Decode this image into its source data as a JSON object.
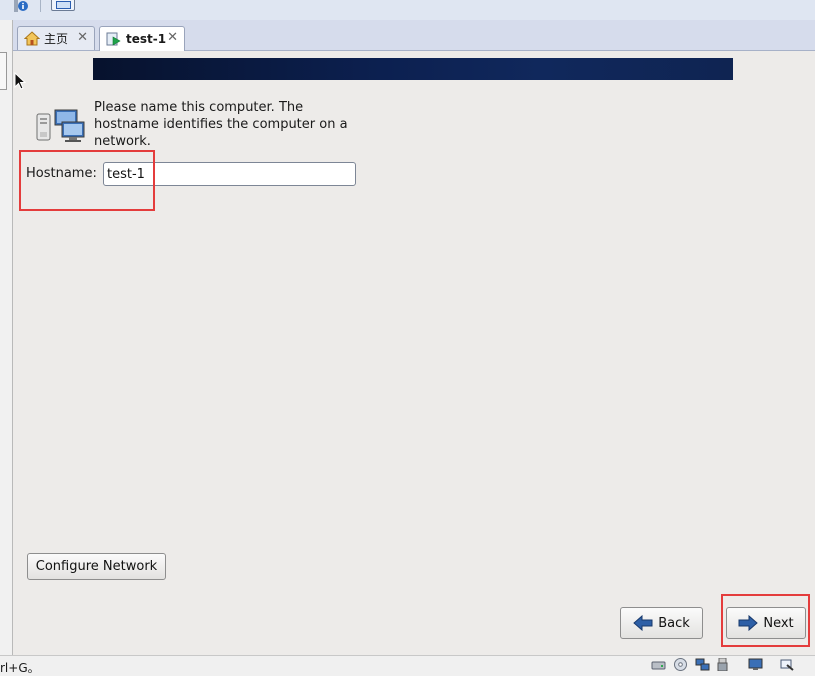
{
  "tabs": [
    {
      "label": "主页",
      "icon": "home-icon"
    },
    {
      "label": "test-1",
      "icon": "vm-running-icon"
    }
  ],
  "tab_close_glyph": "✕",
  "installer": {
    "description": "Please name this computer.  The hostname identifies the computer on a network.",
    "hostname_label": "Hostname:",
    "hostname_value": "test-1",
    "configure_network_label": "Configure Network",
    "back_label": "Back",
    "next_label": "Next"
  },
  "statusbar": {
    "text": "rl+G。",
    "icons": [
      "hard-disk-icon",
      "cd-drive-icon",
      "network-adapter-icon",
      "usb-icon",
      "display-icon",
      "settings-icon"
    ]
  },
  "colors": {
    "highlight": "#e43c3c",
    "banner": "#0c2050"
  }
}
